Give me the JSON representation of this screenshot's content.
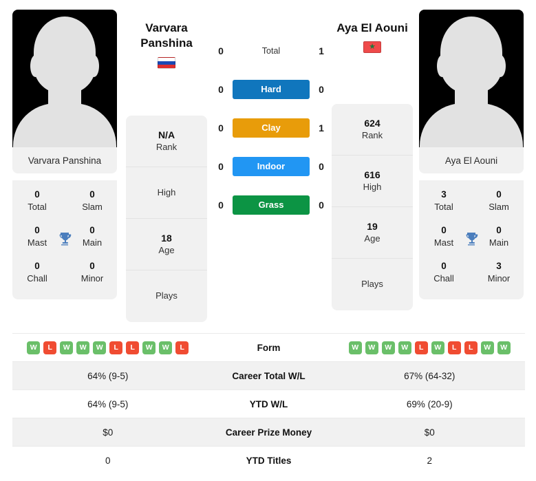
{
  "players": {
    "left": {
      "name": "Varvara Panshina",
      "name_line1": "Varvara",
      "name_line2": "Panshina",
      "flag": "russia-flag",
      "rank": "N/A",
      "rank_label": "Rank",
      "high": "",
      "high_label": "High",
      "age": "18",
      "age_label": "Age",
      "plays": "",
      "plays_label": "Plays",
      "titles": {
        "total": "0",
        "total_label": "Total",
        "slam": "0",
        "slam_label": "Slam",
        "mast": "0",
        "mast_label": "Mast",
        "main": "0",
        "main_label": "Main",
        "chall": "0",
        "chall_label": "Chall",
        "minor": "0",
        "minor_label": "Minor"
      },
      "form": [
        "W",
        "L",
        "W",
        "W",
        "W",
        "L",
        "L",
        "W",
        "W",
        "L"
      ],
      "career_total_wl": "64% (9-5)",
      "ytd_wl": "64% (9-5)",
      "career_prize_money": "$0",
      "ytd_titles": "0"
    },
    "right": {
      "name": "Aya El Aouni",
      "name_line1": "Aya El Aouni",
      "name_line2": "",
      "flag": "morocco-flag",
      "rank": "624",
      "rank_label": "Rank",
      "high": "616",
      "high_label": "High",
      "age": "19",
      "age_label": "Age",
      "plays": "",
      "plays_label": "Plays",
      "titles": {
        "total": "3",
        "total_label": "Total",
        "slam": "0",
        "slam_label": "Slam",
        "mast": "0",
        "mast_label": "Mast",
        "main": "0",
        "main_label": "Main",
        "chall": "0",
        "chall_label": "Chall",
        "minor": "3",
        "minor_label": "Minor"
      },
      "form": [
        "W",
        "W",
        "W",
        "W",
        "L",
        "W",
        "L",
        "L",
        "W",
        "W"
      ],
      "career_total_wl": "67% (64-32)",
      "ytd_wl": "69% (20-9)",
      "career_prize_money": "$0",
      "ytd_titles": "2"
    }
  },
  "h2h": {
    "rows": [
      {
        "label": "Total",
        "left": "0",
        "right": "1",
        "style": "plain",
        "color": ""
      },
      {
        "label": "Hard",
        "left": "0",
        "right": "0",
        "style": "pill",
        "color": "#1076bd"
      },
      {
        "label": "Clay",
        "left": "0",
        "right": "1",
        "style": "pill",
        "color": "#e89c0a"
      },
      {
        "label": "Indoor",
        "left": "0",
        "right": "0",
        "style": "pill",
        "color": "#2196f3"
      },
      {
        "label": "Grass",
        "left": "0",
        "right": "0",
        "style": "pill",
        "color": "#0c9444"
      }
    ]
  },
  "comparison": {
    "rows": [
      {
        "label": "Form",
        "type": "form"
      },
      {
        "label": "Career Total W/L",
        "type": "text",
        "key": "career_total_wl"
      },
      {
        "label": "YTD W/L",
        "type": "text",
        "key": "ytd_wl"
      },
      {
        "label": "Career Prize Money",
        "type": "text",
        "key": "career_prize_money"
      },
      {
        "label": "YTD Titles",
        "type": "text",
        "key": "ytd_titles"
      }
    ]
  },
  "colors": {
    "win": "#6abf69",
    "loss": "#f04c32",
    "card_bg": "#f1f1f1",
    "row_alt": "#f1f1f1"
  }
}
